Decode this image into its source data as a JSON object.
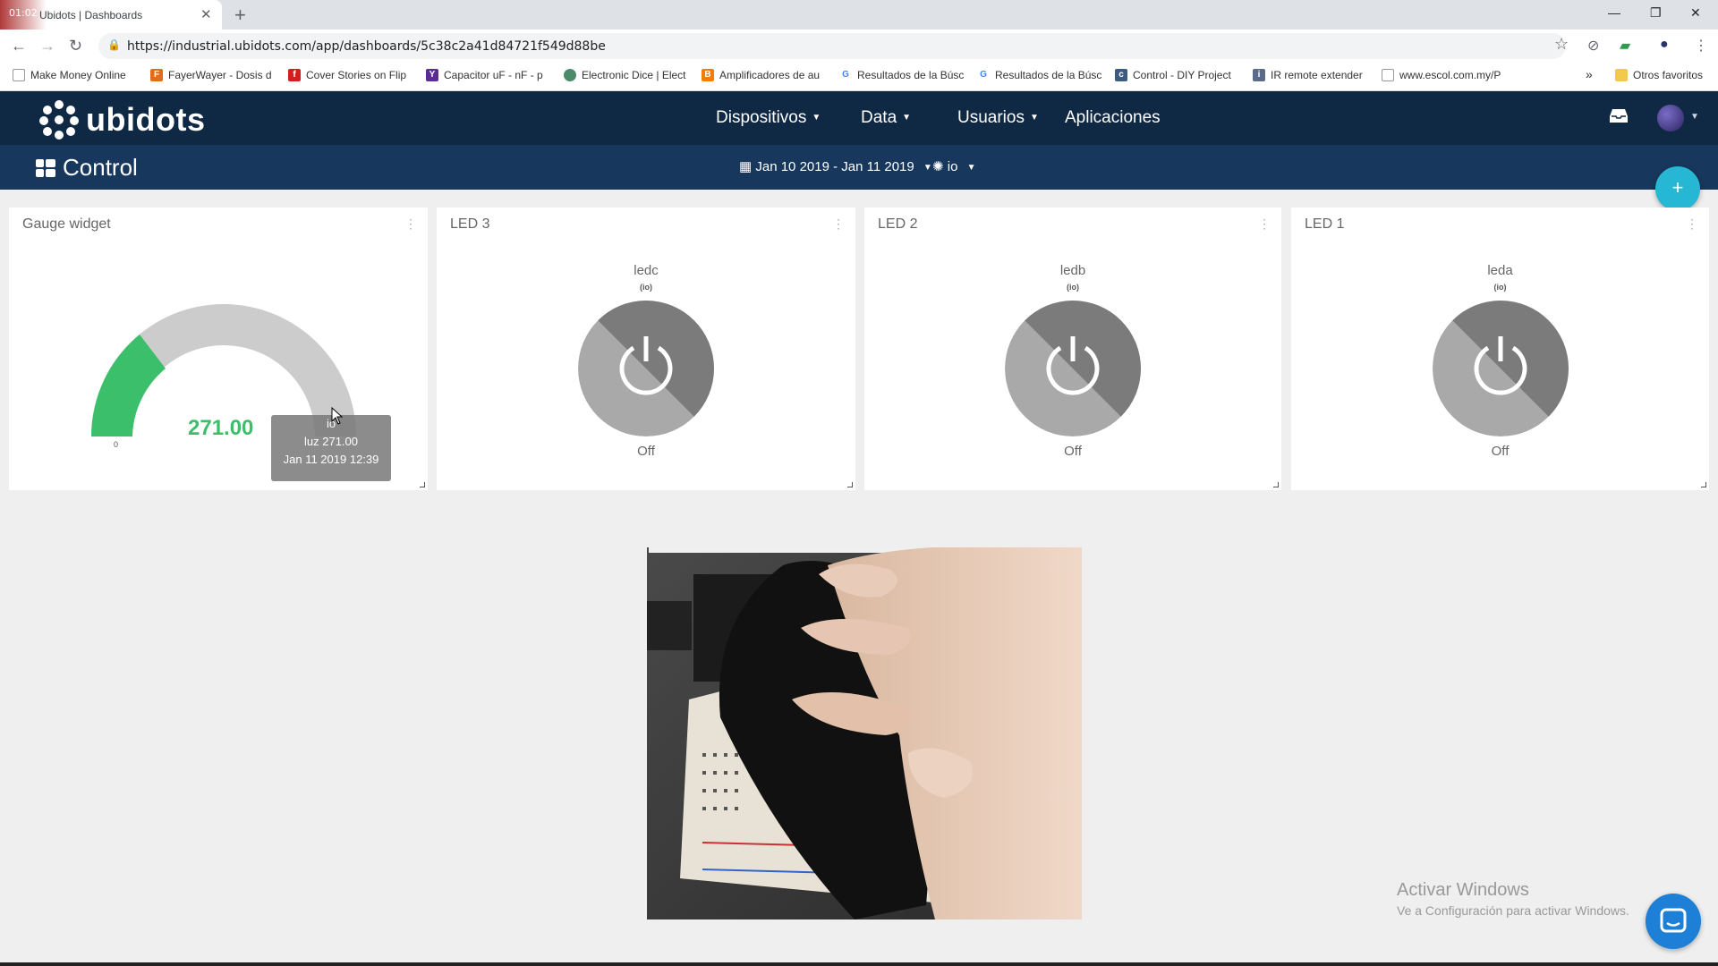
{
  "browser": {
    "tab_time": "01:02",
    "tab_title": "Ubidots | Dashboards",
    "url": "https://industrial.ubidots.com/app/dashboards/5c38c2a41d84721f549d88be",
    "bookmarks": [
      "Make Money Online",
      "FayerWayer - Dosis d",
      "Cover Stories on Flip",
      "Capacitor uF - nF - p",
      "Electronic Dice | Elect",
      "Amplificadores de au",
      "Resultados de la Búsc",
      "Resultados de la Búsc",
      "Control - DIY Project",
      "IR remote extender",
      "www.escol.com.my/P"
    ],
    "bookmarks_more": "»",
    "other_bookmarks": "Otros favoritos"
  },
  "header": {
    "logo": "ubidots",
    "nav": [
      "Dispositivos",
      "Data",
      "Usuarios",
      "Aplicaciones"
    ]
  },
  "dashboard": {
    "title": "Control",
    "date_range": "Jan 10 2019 - Jan 11 2019",
    "device": "io"
  },
  "widgets": {
    "gauge": {
      "title": "Gauge widget",
      "value": "271.00",
      "min": "0",
      "tooltip": {
        "device": "io",
        "line1": "luz 271.00",
        "line2": "Jan 11 2019 12:39"
      }
    },
    "leds": [
      {
        "title": "LED 3",
        "variable": "ledc",
        "device": "(io)",
        "state": "Off"
      },
      {
        "title": "LED 2",
        "variable": "ledb",
        "device": "(io)",
        "state": "Off"
      },
      {
        "title": "LED 1",
        "variable": "leda",
        "device": "(io)",
        "state": "Off"
      }
    ]
  },
  "watermark": {
    "line1": "Activar Windows",
    "line2": "Ve a Configuración para activar Windows."
  },
  "colors": {
    "nav_bg": "#0f2844",
    "subbar_bg": "#17375c",
    "gauge_fill": "#3bbf6a",
    "fab": "#25b7d3"
  }
}
